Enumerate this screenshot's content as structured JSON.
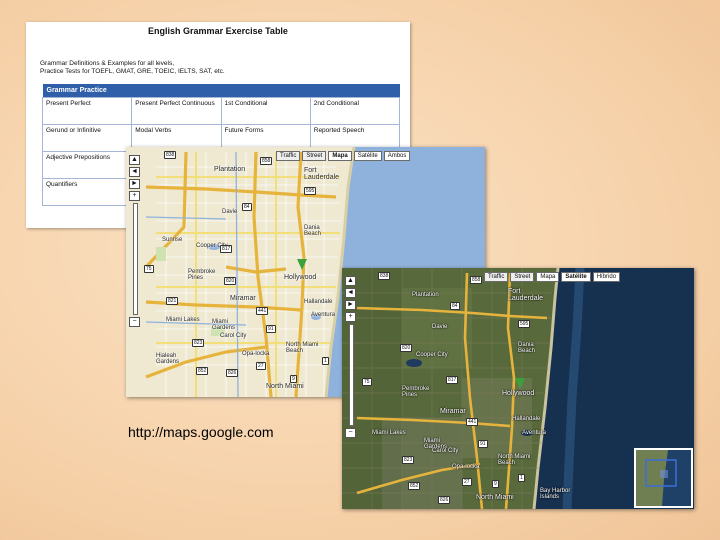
{
  "grammar_page": {
    "title": "English Grammar Exercise Table",
    "intro_line1": "Grammar Definitions & Examples for all levels,",
    "intro_line2": "Practice Tests for TOEFL, GMAT, GRE, TOEIC, IELTS, SAT, etc.",
    "table_header": "Grammar Practice",
    "rows": [
      [
        "Present Perfect",
        "Present Perfect Continuous",
        "1st Conditional",
        "2nd Conditional"
      ],
      [
        "Gerund or Infinitive",
        "Modal Verbs",
        "Future Forms",
        "Reported Speech"
      ],
      [
        "Adjective Prepositions",
        "",
        "",
        ""
      ],
      [
        "Quantifiers",
        "",
        "",
        ""
      ]
    ]
  },
  "map_window_1": {
    "tabs": [
      "Traffic",
      "Street",
      "Mapa",
      "Satélite",
      "Ambos"
    ],
    "active_tab": "Mapa",
    "places": [
      "Plantation",
      "Fort Lauderdale",
      "Cooper City",
      "Hollywood",
      "Pembroke Pines",
      "Miramar",
      "Hallandale",
      "Aventura",
      "North Miami Beach",
      "Miami Gardens",
      "Dania Beach",
      "Carol City",
      "Opa-locka",
      "North Miami",
      "Sunrise",
      "Davie",
      "Hialeah Gardens",
      "Miami Lakes"
    ],
    "route_shields": [
      "838",
      "441",
      "817",
      "823",
      "84",
      "595",
      "820",
      "821",
      "852",
      "858",
      "826",
      "27",
      "91",
      "1",
      "9",
      "75"
    ],
    "zoom_in": "+",
    "zoom_out": "−",
    "pan_up": "▲",
    "pan_left": "◄",
    "pan_right": "►"
  },
  "map_window_2": {
    "tabs": [
      "Traffic",
      "Street",
      "Mapa",
      "Satélite",
      "Híbrido"
    ],
    "active_tab": "Satélite",
    "places": [
      "Fort Lauderdale",
      "Hollywood",
      "Plantation",
      "Davie",
      "Cooper City",
      "Pembroke Pines",
      "Miramar",
      "Hallandale",
      "North Miami Beach",
      "Aventura",
      "Miami Gardens",
      "Opa-locka",
      "Bay Harbor Islands",
      "North Miami",
      "Dania Beach",
      "Miami Lakes",
      "Carol City"
    ],
    "route_shields": [
      "838",
      "441",
      "817",
      "823",
      "84",
      "595",
      "820",
      "852",
      "858",
      "826",
      "1",
      "9",
      "27",
      "91",
      "75"
    ],
    "zoom_in": "+",
    "zoom_out": "−",
    "pan_up": "▲",
    "pan_left": "◄",
    "pan_right": "►"
  },
  "caption": {
    "url": "http://maps.google.com"
  },
  "colors": {
    "background": "#f6d2aa",
    "table_header": "#2f5fa8",
    "ocean": "#8fb2dc",
    "land": "#efe9d2",
    "highway": "#e6b43c",
    "marker": "#3ca13c",
    "satellite_land": "#586a3c",
    "satellite_ocean": "#16304f"
  }
}
